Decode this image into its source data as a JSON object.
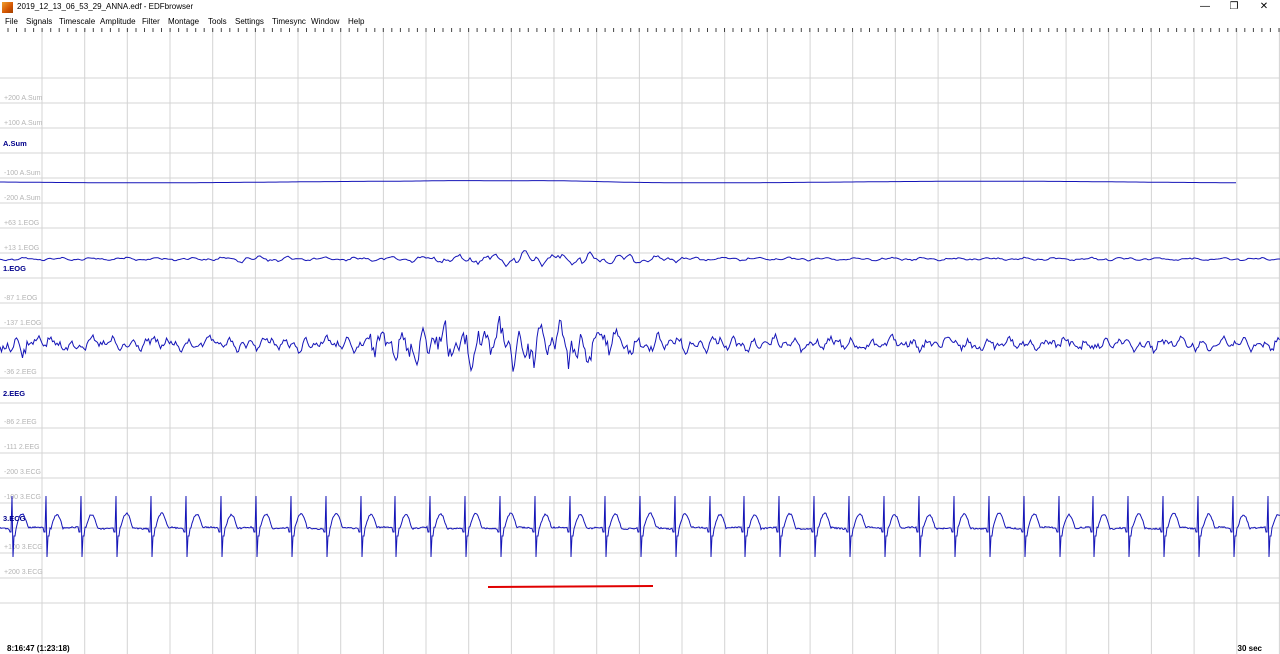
{
  "window": {
    "title": "2019_12_13_06_53_29_ANNA.edf - EDFbrowser",
    "buttons": {
      "minimize": "—",
      "restore": "❐",
      "close": "✕"
    }
  },
  "menu": [
    {
      "id": "file",
      "label": "File"
    },
    {
      "id": "signals",
      "label": "Signals"
    },
    {
      "id": "timescale",
      "label": "Timescale"
    },
    {
      "id": "amplitude",
      "label": "Amplitude"
    },
    {
      "id": "filter",
      "label": "Filter"
    },
    {
      "id": "montage",
      "label": "Montage"
    },
    {
      "id": "tools",
      "label": "Tools"
    },
    {
      "id": "settings",
      "label": "Settings"
    },
    {
      "id": "timesync",
      "label": "Timesync"
    },
    {
      "id": "window",
      "label": "Window"
    },
    {
      "id": "help",
      "label": "Help"
    }
  ],
  "signals": [
    {
      "label": "A.Sum",
      "scale": [
        "+200 A.Sum",
        "+100 A.Sum",
        "-100 A.Sum",
        "-200 A.Sum"
      ]
    },
    {
      "label": "1.EOG",
      "scale": [
        "+63 1.EOG",
        "+13 1.EOG",
        "-87 1.EOG",
        "-137 1.EOG"
      ]
    },
    {
      "label": "2.EEG",
      "scale": [
        "-36 2.EEG",
        "-86 2.EEG",
        "-111 2.EEG"
      ]
    },
    {
      "label": "3.ECG",
      "scale": [
        "-200 3.ECG",
        "-100 3.ECG",
        "+100 3.ECG",
        "+200 3.ECG"
      ]
    }
  ],
  "status": {
    "time": "8:16:47 (1:23:18)",
    "timescale": "30 sec"
  },
  "colors": {
    "trace": "#1515b8",
    "label": "#00008b",
    "grid": "#d4d4d4",
    "scale": "#b4b4b4",
    "annotation": "#e00000"
  }
}
